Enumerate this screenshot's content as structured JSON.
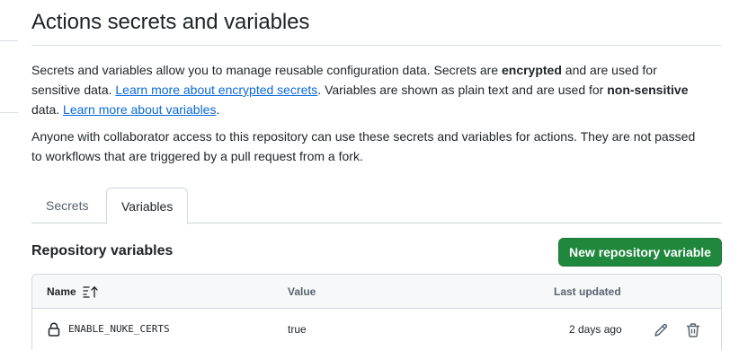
{
  "page": {
    "title": "Actions secrets and variables"
  },
  "intro": {
    "p1_a": "Secrets and variables allow you to manage reusable configuration data. Secrets are ",
    "p1_b": "encrypted",
    "p1_c": " and are used for sensitive data. ",
    "p1_link1": "Learn more about encrypted secrets",
    "p1_d": ". Variables are shown as plain text and are used for ",
    "p1_e": "non-sensitive",
    "p1_f": " data. ",
    "p1_link2": "Learn more about variables",
    "p1_g": ".",
    "p2": "Anyone with collaborator access to this repository can use these secrets and variables for actions. They are not passed to workflows that are triggered by a pull request from a fork."
  },
  "tabs": [
    {
      "label": "Secrets",
      "active": false
    },
    {
      "label": "Variables",
      "active": true
    }
  ],
  "section": {
    "title": "Repository variables",
    "new_button": "New repository variable"
  },
  "table": {
    "headers": {
      "name": "Name",
      "value": "Value",
      "updated": "Last updated"
    },
    "rows": [
      {
        "name": "ENABLE_NUKE_CERTS",
        "value": "true",
        "updated": "2 days ago"
      }
    ]
  },
  "colors": {
    "accent_link": "#0969da",
    "primary_button": "#1f883d",
    "border": "#d0d7de"
  },
  "icons": {
    "sort": "sort-ascending-icon",
    "lock": "lock-icon",
    "edit": "pencil-icon",
    "delete": "trash-icon"
  }
}
